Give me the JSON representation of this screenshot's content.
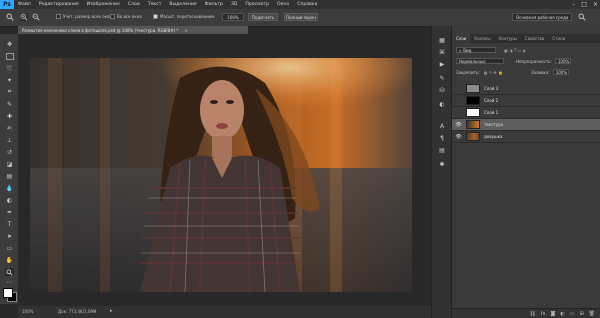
{
  "app": {
    "logo": "Ps",
    "menu": [
      "Файл",
      "Редактирование",
      "Изображение",
      "Слои",
      "Текст",
      "Выделение",
      "Фильтр",
      "3D",
      "Просмотр",
      "Окно",
      "Справка"
    ],
    "window_controls": [
      "–",
      "□",
      "×"
    ]
  },
  "options": {
    "sample_all_windows": "Учет. размер всех окон",
    "all_windows": "Во все окна",
    "scrubby_zoom": "Масшт. перетаскиванием",
    "zoom_value": "100%",
    "fit_screen": "Подогнать",
    "fill_screen": "Полный экран",
    "workspace": "Основная рабочая среда"
  },
  "document": {
    "tab_title": "Размытие колонками слоев в фотошопе.psd @ 100% (текстура, RGB/8#) *",
    "close": "×",
    "zoom_status": "100%",
    "doc_size": "Док: 773,4K/2,09M"
  },
  "layers_panel": {
    "tabs": [
      "Слои",
      "Каналы",
      "Контуры",
      "Свойства",
      "Стили"
    ],
    "active_tab": "Слои",
    "filter_kind": "Вид",
    "blend_mode": "Нормальные",
    "opacity_label": "Непрозрачность:",
    "opacity_value": "100%",
    "lock_label": "Закрепить:",
    "fill_label": "Заливка:",
    "fill_value": "100%",
    "layers": [
      {
        "name": "Слой 3",
        "visible": false,
        "selected": false,
        "thumb": "gray"
      },
      {
        "name": "Слой 2",
        "visible": false,
        "selected": false,
        "thumb": "black"
      },
      {
        "name": "Слой 1",
        "visible": false,
        "selected": false,
        "thumb": "white"
      },
      {
        "name": "текстура",
        "visible": true,
        "selected": true,
        "thumb": "photo"
      },
      {
        "name": "девушка",
        "visible": true,
        "selected": false,
        "thumb": "photo"
      }
    ]
  },
  "colors": {
    "accent": "#31a8ff",
    "panel_bg": "#3a3a3a",
    "selected_layer": "#5e5e5e"
  }
}
